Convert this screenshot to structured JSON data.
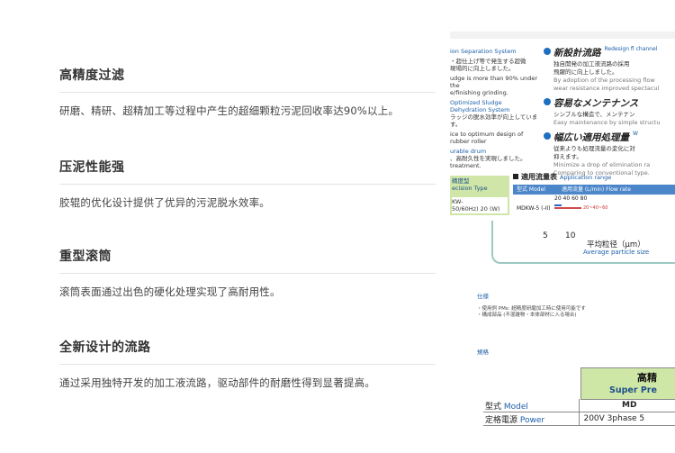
{
  "features": [
    {
      "title": "高精度过滤",
      "desc": "研磨、精研、超精加工等过程中产生的超细颗粒污泥回收率达90%以上。"
    },
    {
      "title": "压泥性能强",
      "desc": "胶辊的优化设计提供了优异的污泥脱水效率。"
    },
    {
      "title": "重型滚筒",
      "desc": "滚筒表面通过出色的硬化处理实现了高耐用性。"
    },
    {
      "title": "全新设计的流路",
      "desc": "通过采用独特开发的加工液流路，驱动部件的耐磨性得到显著提高。"
    }
  ],
  "brochure": {
    "left_lines": [
      "ion Separation System",
      "・超仕上げ等で発生する超微",
      "現場的に向上しました。",
      "udge is more than 90% under the",
      "e/finishing grinding.",
      "Optimized Sludge",
      "Dehydration System",
      "ラッジの脱水効率が向上しています。",
      "ice to optimum design of rubber roller",
      "urable drum",
      "、高耐久性を実現しました。",
      "treatment."
    ],
    "blocks": [
      {
        "title": "新設計流路",
        "en": "Redesign fl channel",
        "lines": [
          "独自開発の加工液流路の採用",
          "飛躍的に向上しました。"
        ],
        "en_lines": [
          "By adoption of the processing flow",
          "wear resistance improved spectacul"
        ]
      },
      {
        "title": "容易なメンテナンス",
        "en": "",
        "lines": [
          "シンプルな構造で、メンテナン"
        ],
        "en_lines": [
          "Easy maintenance by simple structu"
        ]
      },
      {
        "title": "幅広い適用処理量",
        "en": "W",
        "lines": [
          "従来よりも処理流量の変化に対",
          "抑えます。"
        ],
        "en_lines": [
          "Minimize a drop of elimination ra",
          "Comparing to conventional type."
        ]
      }
    ],
    "type_box": {
      "line1": "精度型",
      "line2": "ecision Type",
      "line3": "KW-",
      "line4": "50/60Hz) 20 (W)"
    },
    "flow": {
      "title": "適用流量表",
      "title_en": "Application range",
      "col1": "型式 Model",
      "col2": "適用流量 (L/min) Flow rate",
      "scale": "20  40  60  80",
      "model": "MDKW-5 (-II)",
      "range_label": "20~40~60"
    },
    "ticks": [
      "5",
      "10"
    ],
    "particle_jp": "平均粒径（μm）",
    "particle_en": "Average particle size",
    "section1": "仕様",
    "notes": [
      "・使用例 PMs: 超精度研磨加工時に使用可能です",
      "・構成部品 (不混雑物・本体部材に入る場合)"
    ],
    "section2": "規格",
    "spec": {
      "head_jp": "高精",
      "head_en": "Super Pre",
      "rows": [
        {
          "k_jp": "型式",
          "k_en": "Model",
          "v": "MD"
        },
        {
          "k_jp": "定格電源",
          "k_en": "Power",
          "v": "200V  3phase  5"
        }
      ]
    }
  }
}
